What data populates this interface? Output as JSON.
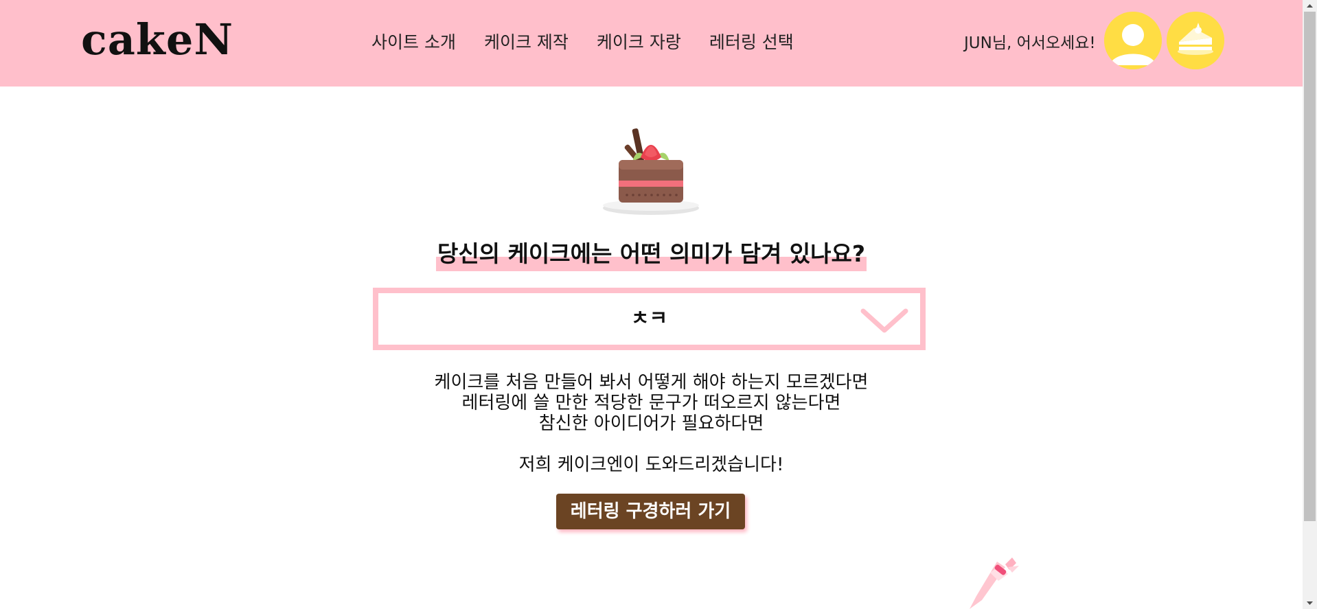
{
  "header": {
    "logo": "cakeN",
    "nav": [
      {
        "label": "사이트 소개"
      },
      {
        "label": "케이크 제작"
      },
      {
        "label": "케이크 자랑"
      },
      {
        "label": "레터링 선택"
      }
    ],
    "greeting": "JUN님, 어서오세요!",
    "icons": {
      "user": "user-avatar-icon",
      "cake": "cake-slice-icon"
    }
  },
  "main": {
    "hero_icon": "chocolate-cake-icon",
    "question": "당신의 케이크에는 어떤 의미가 담겨 있나요?",
    "select": {
      "value": "ㅊㅋ"
    },
    "intro_lines": [
      "케이크를 처음 만들어 봐서 어떻게 해야 하는지 모르겠다면",
      "레터링에 쓸 만한 적당한 문구가 떠오르지 않는다면",
      "참신한 아이디어가 필요하다면"
    ],
    "tagline": "저희 케이크엔이 도와드리겠습니다!",
    "cta_label": "레터링 구경하러 가기",
    "decor_icon": "piping-bag-icon"
  },
  "colors": {
    "header_bg": "#ffbfcb",
    "accent_pink": "#ffc0cb",
    "avatar_yellow": "#ffdd44",
    "cta_brown": "#6b4423"
  }
}
